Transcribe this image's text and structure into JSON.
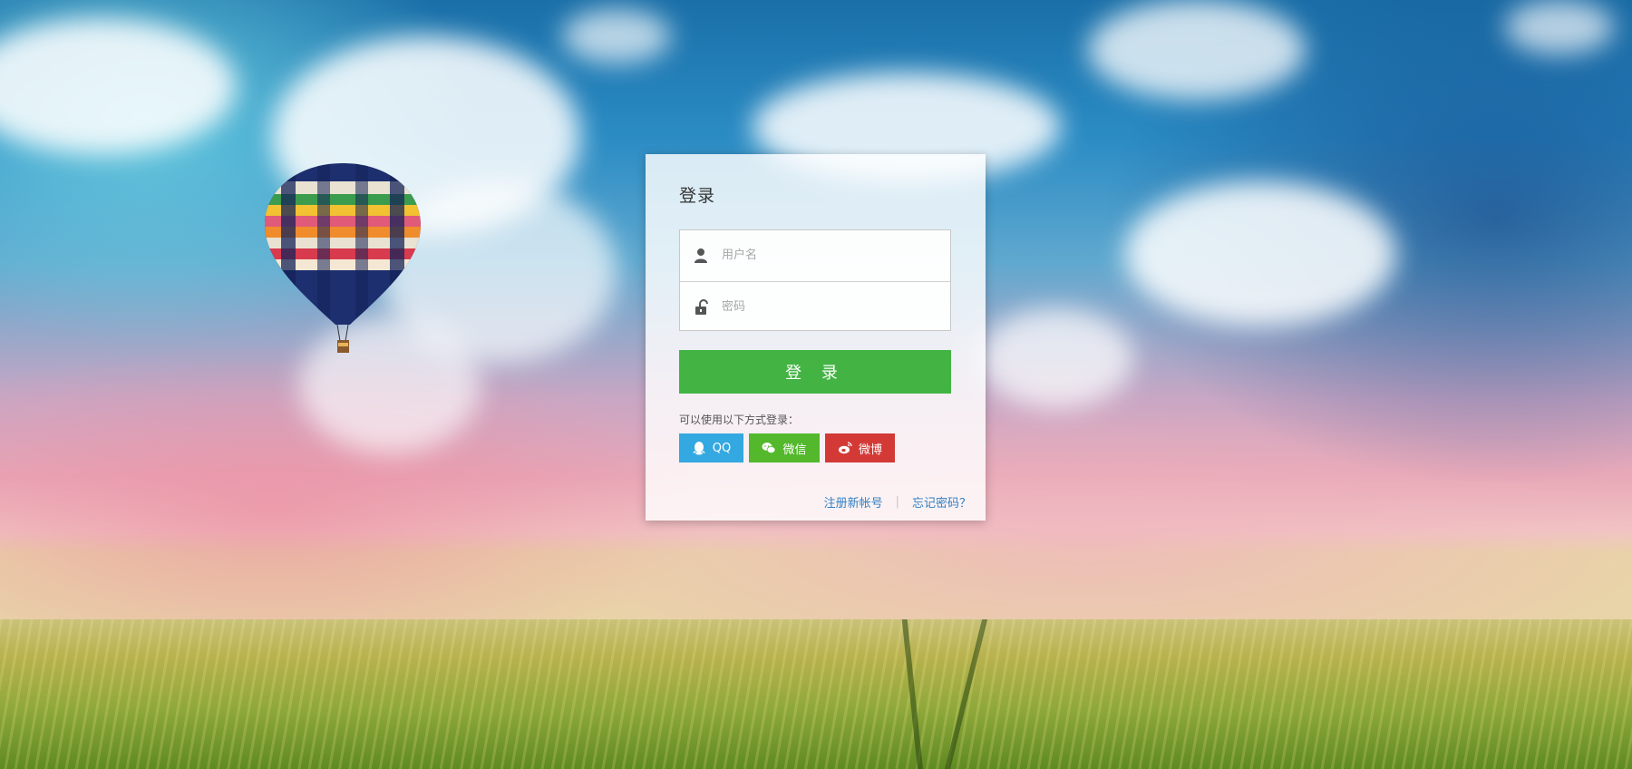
{
  "login": {
    "title": "登录",
    "username_placeholder": "用户名",
    "password_placeholder": "密码",
    "submit_label": "登 录",
    "alt_login_label": "可以使用以下方式登录：",
    "social": [
      {
        "label": "QQ",
        "color": "#34a8e0",
        "icon": "qq-icon"
      },
      {
        "label": "微信",
        "color": "#53b82c",
        "icon": "wechat-icon"
      },
      {
        "label": "微博",
        "color": "#d33a36",
        "icon": "weibo-icon"
      }
    ],
    "register_link": "注册新帐号",
    "forgot_link": "忘记密码？"
  },
  "colors": {
    "primary_button": "#43b443",
    "link": "#2f7fc4"
  }
}
